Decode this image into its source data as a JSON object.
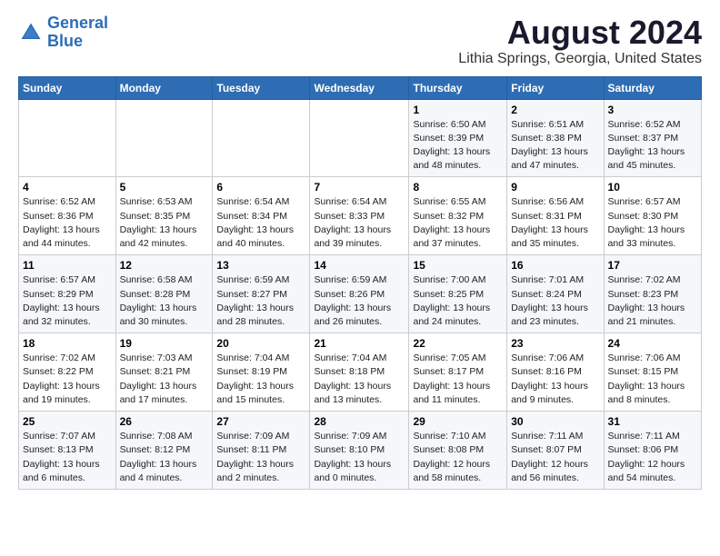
{
  "header": {
    "logo_line1": "General",
    "logo_line2": "Blue",
    "title": "August 2024",
    "subtitle": "Lithia Springs, Georgia, United States"
  },
  "calendar": {
    "columns": [
      "Sunday",
      "Monday",
      "Tuesday",
      "Wednesday",
      "Thursday",
      "Friday",
      "Saturday"
    ],
    "weeks": [
      {
        "days": [
          {
            "num": "",
            "info": ""
          },
          {
            "num": "",
            "info": ""
          },
          {
            "num": "",
            "info": ""
          },
          {
            "num": "",
            "info": ""
          },
          {
            "num": "1",
            "info": "Sunrise: 6:50 AM\nSunset: 8:39 PM\nDaylight: 13 hours\nand 48 minutes."
          },
          {
            "num": "2",
            "info": "Sunrise: 6:51 AM\nSunset: 8:38 PM\nDaylight: 13 hours\nand 47 minutes."
          },
          {
            "num": "3",
            "info": "Sunrise: 6:52 AM\nSunset: 8:37 PM\nDaylight: 13 hours\nand 45 minutes."
          }
        ]
      },
      {
        "days": [
          {
            "num": "4",
            "info": "Sunrise: 6:52 AM\nSunset: 8:36 PM\nDaylight: 13 hours\nand 44 minutes."
          },
          {
            "num": "5",
            "info": "Sunrise: 6:53 AM\nSunset: 8:35 PM\nDaylight: 13 hours\nand 42 minutes."
          },
          {
            "num": "6",
            "info": "Sunrise: 6:54 AM\nSunset: 8:34 PM\nDaylight: 13 hours\nand 40 minutes."
          },
          {
            "num": "7",
            "info": "Sunrise: 6:54 AM\nSunset: 8:33 PM\nDaylight: 13 hours\nand 39 minutes."
          },
          {
            "num": "8",
            "info": "Sunrise: 6:55 AM\nSunset: 8:32 PM\nDaylight: 13 hours\nand 37 minutes."
          },
          {
            "num": "9",
            "info": "Sunrise: 6:56 AM\nSunset: 8:31 PM\nDaylight: 13 hours\nand 35 minutes."
          },
          {
            "num": "10",
            "info": "Sunrise: 6:57 AM\nSunset: 8:30 PM\nDaylight: 13 hours\nand 33 minutes."
          }
        ]
      },
      {
        "days": [
          {
            "num": "11",
            "info": "Sunrise: 6:57 AM\nSunset: 8:29 PM\nDaylight: 13 hours\nand 32 minutes."
          },
          {
            "num": "12",
            "info": "Sunrise: 6:58 AM\nSunset: 8:28 PM\nDaylight: 13 hours\nand 30 minutes."
          },
          {
            "num": "13",
            "info": "Sunrise: 6:59 AM\nSunset: 8:27 PM\nDaylight: 13 hours\nand 28 minutes."
          },
          {
            "num": "14",
            "info": "Sunrise: 6:59 AM\nSunset: 8:26 PM\nDaylight: 13 hours\nand 26 minutes."
          },
          {
            "num": "15",
            "info": "Sunrise: 7:00 AM\nSunset: 8:25 PM\nDaylight: 13 hours\nand 24 minutes."
          },
          {
            "num": "16",
            "info": "Sunrise: 7:01 AM\nSunset: 8:24 PM\nDaylight: 13 hours\nand 23 minutes."
          },
          {
            "num": "17",
            "info": "Sunrise: 7:02 AM\nSunset: 8:23 PM\nDaylight: 13 hours\nand 21 minutes."
          }
        ]
      },
      {
        "days": [
          {
            "num": "18",
            "info": "Sunrise: 7:02 AM\nSunset: 8:22 PM\nDaylight: 13 hours\nand 19 minutes."
          },
          {
            "num": "19",
            "info": "Sunrise: 7:03 AM\nSunset: 8:21 PM\nDaylight: 13 hours\nand 17 minutes."
          },
          {
            "num": "20",
            "info": "Sunrise: 7:04 AM\nSunset: 8:19 PM\nDaylight: 13 hours\nand 15 minutes."
          },
          {
            "num": "21",
            "info": "Sunrise: 7:04 AM\nSunset: 8:18 PM\nDaylight: 13 hours\nand 13 minutes."
          },
          {
            "num": "22",
            "info": "Sunrise: 7:05 AM\nSunset: 8:17 PM\nDaylight: 13 hours\nand 11 minutes."
          },
          {
            "num": "23",
            "info": "Sunrise: 7:06 AM\nSunset: 8:16 PM\nDaylight: 13 hours\nand 9 minutes."
          },
          {
            "num": "24",
            "info": "Sunrise: 7:06 AM\nSunset: 8:15 PM\nDaylight: 13 hours\nand 8 minutes."
          }
        ]
      },
      {
        "days": [
          {
            "num": "25",
            "info": "Sunrise: 7:07 AM\nSunset: 8:13 PM\nDaylight: 13 hours\nand 6 minutes."
          },
          {
            "num": "26",
            "info": "Sunrise: 7:08 AM\nSunset: 8:12 PM\nDaylight: 13 hours\nand 4 minutes."
          },
          {
            "num": "27",
            "info": "Sunrise: 7:09 AM\nSunset: 8:11 PM\nDaylight: 13 hours\nand 2 minutes."
          },
          {
            "num": "28",
            "info": "Sunrise: 7:09 AM\nSunset: 8:10 PM\nDaylight: 13 hours\nand 0 minutes."
          },
          {
            "num": "29",
            "info": "Sunrise: 7:10 AM\nSunset: 8:08 PM\nDaylight: 12 hours\nand 58 minutes."
          },
          {
            "num": "30",
            "info": "Sunrise: 7:11 AM\nSunset: 8:07 PM\nDaylight: 12 hours\nand 56 minutes."
          },
          {
            "num": "31",
            "info": "Sunrise: 7:11 AM\nSunset: 8:06 PM\nDaylight: 12 hours\nand 54 minutes."
          }
        ]
      }
    ]
  }
}
